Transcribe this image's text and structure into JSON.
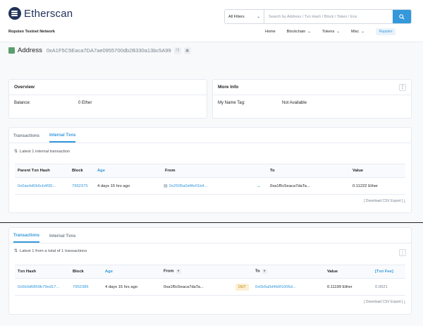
{
  "header": {
    "brand": "Etherscan",
    "network": "Ropsten Testnet Network",
    "search_filter": "All Filters",
    "search_placeholder": "Search by Address / Txn Hash / Block / Token / Ens",
    "nav": [
      "Home",
      "Blockchain",
      "Tokens",
      "Misc"
    ],
    "network_badge": "Ropsten"
  },
  "address": {
    "label": "Address",
    "hash": "0xA1F5C5Eaca7DA7ae0955700db2B330a13bc5A99"
  },
  "overview": {
    "title": "Overview",
    "balance_label": "Balance:",
    "balance_value": "0 Ether"
  },
  "more_info": {
    "title": "More Info",
    "tag_label": "My Name Tag:",
    "tag_value": "Not Available"
  },
  "upper_panel": {
    "tabs": [
      "Transactions",
      "Internal Txns"
    ],
    "active_tab": 1,
    "summary": "Latest 1 internal transaction",
    "columns": [
      "Parent Txn Hash",
      "Block",
      "Age",
      "From",
      "To",
      "Value"
    ],
    "row": {
      "parent_hash": "0x0ae4d0b5cb4f30...",
      "block": "7952375",
      "age": "4 days 15 hrs ago",
      "from": "0x2505a0d4fe01b4...",
      "to": "0xa1f5c5eaca7daTa...",
      "value": "0.11222 Ether"
    },
    "download": "[ Download CSV Export ]"
  },
  "lower_panel": {
    "tabs": [
      "Transactions",
      "Internal Txns"
    ],
    "active_tab": 0,
    "summary": "Latest 1 from a total of 1 transactions",
    "columns": [
      "Txn Hash",
      "Block",
      "Age",
      "From",
      "To",
      "Value",
      "[Txn Fee]"
    ],
    "row": {
      "hash": "0x5b0d6869b79ed17...",
      "block": "7952386",
      "age": "4 days 15 hrs ago",
      "from": "0xa1f5c5eaca7daTa...",
      "direction": "OUT",
      "to": "0x0b5a0d4b0f1006d...",
      "value": "0.11199 Ether",
      "fee": "0.0021"
    },
    "download": "[ Download CSV Export ]"
  },
  "colors": {
    "accent": "#3498db",
    "brand": "#21325b",
    "green": "#00a186"
  }
}
